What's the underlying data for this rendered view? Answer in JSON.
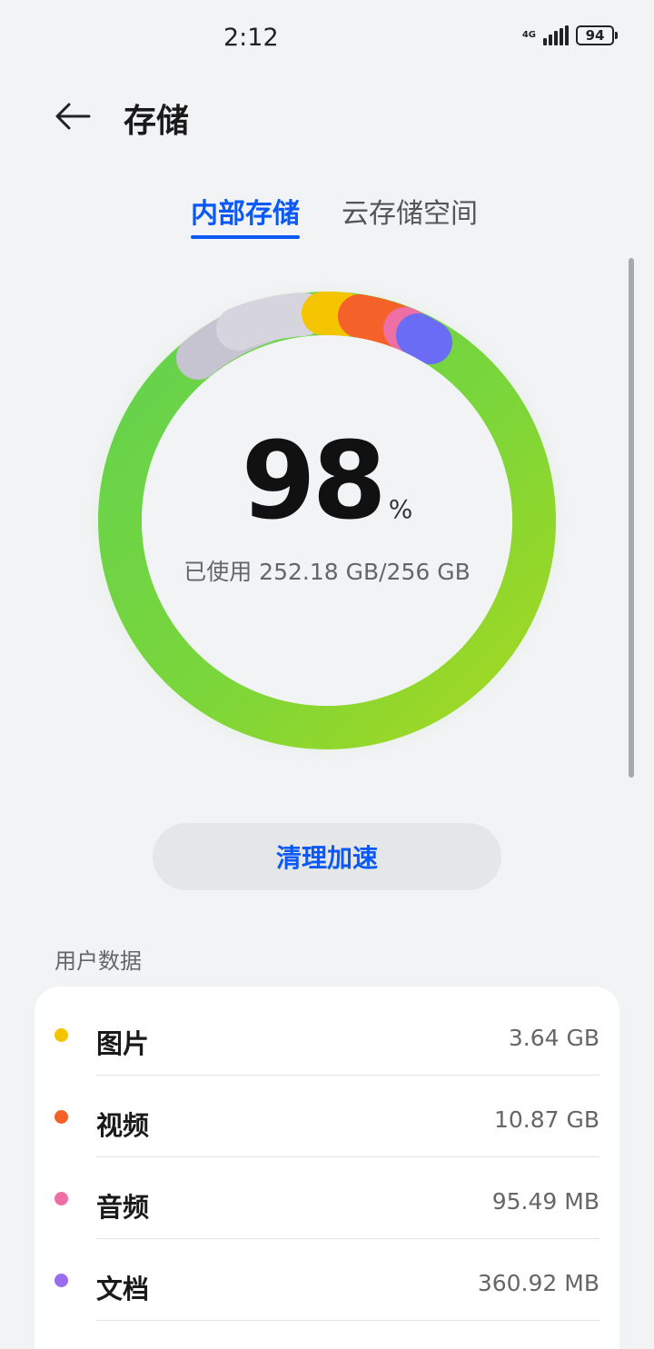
{
  "status_bar": {
    "time": "2:12",
    "network": "4G",
    "battery": "94"
  },
  "header": {
    "title": "存储",
    "back_icon": "arrow-left-icon"
  },
  "tabs": [
    {
      "label": "内部存储",
      "active": true
    },
    {
      "label": "云存储空间",
      "active": false
    }
  ],
  "storage": {
    "percent": "98",
    "percent_unit": "%",
    "used_text": "已使用 252.18 GB/256 GB",
    "used_fraction": 0.98
  },
  "clean_button": {
    "label": "清理加速"
  },
  "user_data": {
    "section_label": "用户数据",
    "items": [
      {
        "name": "图片",
        "size": "3.64 GB",
        "color": "#f5c400"
      },
      {
        "name": "视频",
        "size": "10.87 GB",
        "color": "#f4622a"
      },
      {
        "name": "音频",
        "size": "95.49 MB",
        "color": "#ee6fa5"
      },
      {
        "name": "文档",
        "size": "360.92 MB",
        "color": "#9a6cf0"
      }
    ]
  },
  "colors": {
    "accent": "#0a59f7",
    "ring_green": "#6fd44e",
    "ring_lime": "#a2d622",
    "ring_gray": "#c8c8d2",
    "ring_blue": "#6a6cf5"
  }
}
